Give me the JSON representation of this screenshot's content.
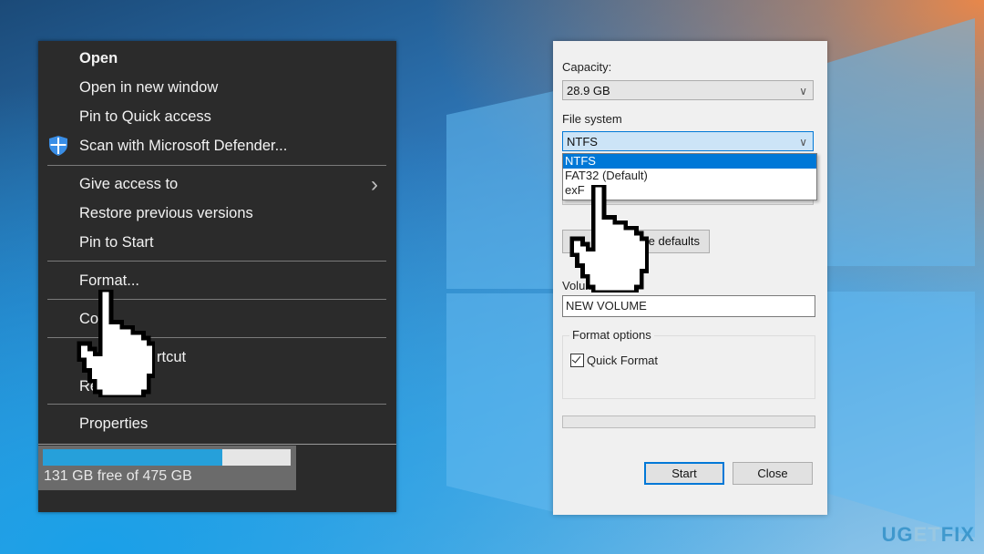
{
  "context_menu": {
    "items": [
      {
        "label": "Open",
        "bold": true
      },
      {
        "label": "Open in new window"
      },
      {
        "label": "Pin to Quick access"
      },
      {
        "label": "Scan with Microsoft Defender...",
        "icon": "shield-icon"
      },
      {
        "label": "Give access to",
        "submenu": true
      },
      {
        "label": "Restore previous versions"
      },
      {
        "label": "Pin to Start"
      },
      {
        "label": "Format..."
      },
      {
        "label": "Co"
      },
      {
        "label": "rtcut"
      },
      {
        "label": "Re"
      },
      {
        "label": "Properties"
      }
    ],
    "drive_usage": {
      "used_fraction": 0.724,
      "text": "131 GB free of 475 GB"
    }
  },
  "format_dialog": {
    "capacity_label": "Capacity:",
    "capacity_value": "28.9 GB",
    "file_system_label": "File system",
    "file_system_value": "NTFS",
    "file_system_options": [
      "NTFS",
      "FAT32 (Default)",
      "exF"
    ],
    "selected_option": "NTFS",
    "restore_defaults_label": "e defaults",
    "volume_label_label": "Volum",
    "volume_label_value": "NEW VOLUME",
    "format_options_title": "Format options",
    "quick_format_label": "Quick Format",
    "quick_format_checked": true,
    "progress": 0,
    "start_label": "Start",
    "close_label": "Close"
  },
  "watermark": {
    "left": "UG",
    "mid": "ET",
    "right": "FIX"
  }
}
